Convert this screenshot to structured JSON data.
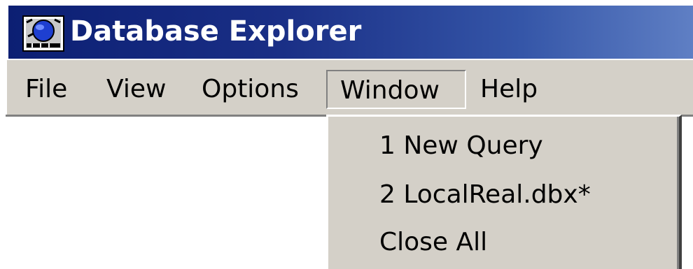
{
  "window": {
    "title": "Database Explorer",
    "icon": "database-globe-icon"
  },
  "menubar": {
    "items": [
      {
        "label": "File"
      },
      {
        "label": "View"
      },
      {
        "label": "Options"
      },
      {
        "label": "Window",
        "active": true
      },
      {
        "label": "Help"
      }
    ]
  },
  "window_menu": {
    "items": [
      {
        "label": "1 New Query"
      },
      {
        "label": "2 LocalReal.dbx*"
      },
      {
        "label": "Close All"
      }
    ]
  },
  "colors": {
    "titlebar_start": "#0c1f73",
    "titlebar_end": "#5f7fc4",
    "menu_face": "#d4d0c8"
  }
}
